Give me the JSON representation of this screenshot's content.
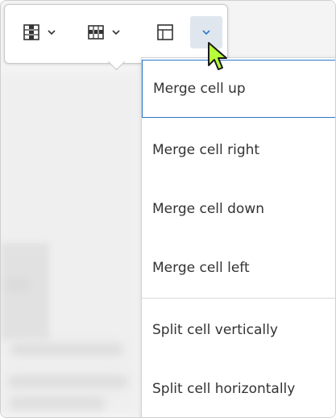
{
  "toolbar": {
    "buttons": [
      {
        "icon": "table-column-icon",
        "has_dropdown": true
      },
      {
        "icon": "table-row-icon",
        "has_dropdown": true
      },
      {
        "icon": "merge-cells-icon",
        "has_dropdown": false
      },
      {
        "icon": "chevron-down-icon",
        "active": true
      }
    ]
  },
  "menu": {
    "items": [
      {
        "label": "Merge cell up",
        "focused": true
      },
      {
        "label": "Merge cell right"
      },
      {
        "label": "Merge cell down"
      },
      {
        "label": "Merge cell left"
      },
      {
        "label": "Split cell vertically"
      },
      {
        "label": "Split cell horizontally"
      }
    ]
  },
  "colors": {
    "focus_border": "#2d77c9",
    "active_button_bg": "#dfe6ee",
    "chevron": "#2d77c9",
    "cursor_fill": "#b6ff3b"
  }
}
